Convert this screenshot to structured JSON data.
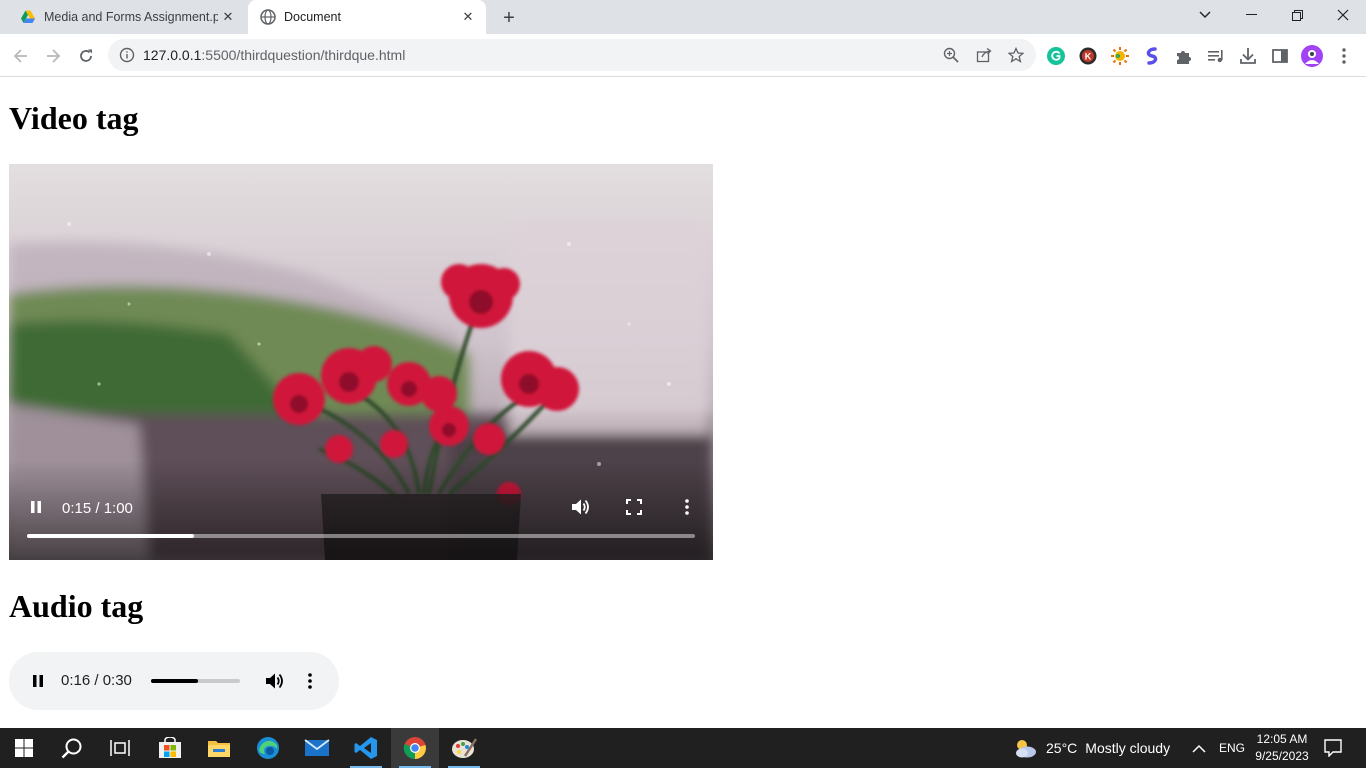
{
  "browser": {
    "tabs": [
      {
        "title": "Media and Forms Assignment.pdf",
        "favicon": "google-drive-icon",
        "active": false
      },
      {
        "title": "Document",
        "favicon": "globe-icon",
        "active": true,
        "playing_audio": true
      }
    ],
    "address_bar": {
      "url_host": "127.0.0.1",
      "url_rest": ":5500/thirdquestion/thirdque.html"
    },
    "extension_icons": [
      "grammarly-icon",
      "k-extension-icon",
      "sun-extension-icon",
      "s-extension-icon",
      "puzzle-icon",
      "media-queue-icon",
      "download-icon",
      "side-panel-icon",
      "profile-avatar",
      "kebab-menu-icon"
    ]
  },
  "page": {
    "video_heading": "Video tag",
    "audio_heading": "Audio tag",
    "video_player": {
      "time_display": "0:15 / 1:00",
      "progress": 0.25,
      "state": "playing"
    },
    "audio_player": {
      "time_display": "0:16 / 0:30",
      "progress": 0.533,
      "state": "playing"
    }
  },
  "taskbar": {
    "weather": {
      "temp": "25°C",
      "condition": "Mostly cloudy"
    },
    "language": "ENG",
    "time": "12:05 AM",
    "date": "9/25/2023",
    "apps": [
      "start-icon",
      "search-icon",
      "task-view-icon",
      "microsoft-store-icon",
      "file-explorer-icon",
      "edge-icon",
      "mail-icon",
      "vscode-icon",
      "chrome-icon",
      "paint-icon"
    ]
  },
  "colors": {
    "tabstrip": "#dee1e6",
    "omnibox": "#f1f3f4",
    "taskbar": "#202020",
    "flower_red": "#d0173b"
  }
}
